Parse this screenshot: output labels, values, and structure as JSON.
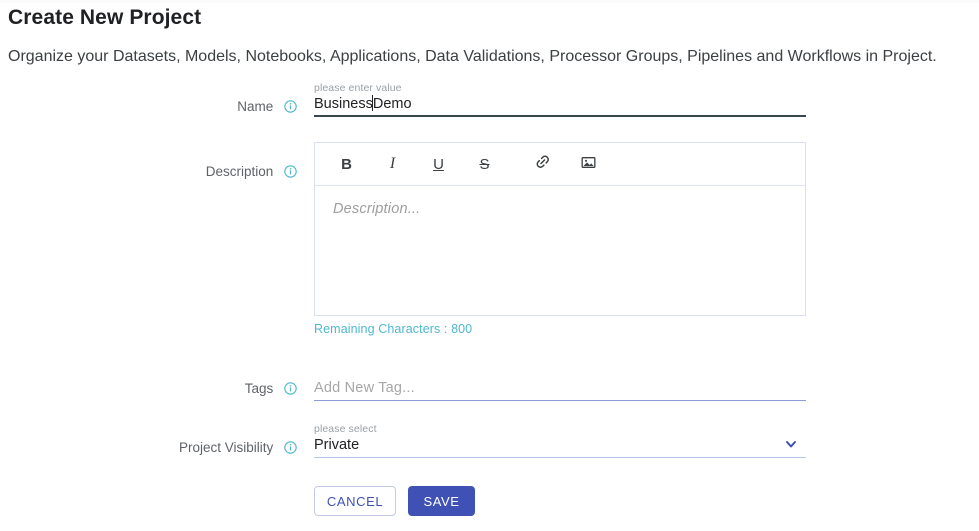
{
  "header": {
    "title": "Create New Project",
    "subtitle": "Organize your Datasets, Models, Notebooks, Applications, Data Validations, Processor Groups, Pipelines and Workflows in Project."
  },
  "colors": {
    "primary": "#3f51b5",
    "info_icon": "#4fb8cf",
    "remaining_text": "#4fb8cf",
    "focused_underline": "#37474f",
    "normal_underline": "#8c9eda",
    "label_text": "#5f6368",
    "placeholder_text": "#a7a7a7"
  },
  "form": {
    "name": {
      "label": "Name",
      "info_icon": "info-circle-icon",
      "placeholder": "please enter value",
      "value_before_caret": "Business",
      "value_after_caret": "Demo",
      "value": "BusinessDemo"
    },
    "description": {
      "label": "Description",
      "info_icon": "info-circle-icon",
      "placeholder": "Description...",
      "value": "",
      "toolbar": [
        {
          "name": "bold-button",
          "label": "B"
        },
        {
          "name": "italic-button",
          "label": "I"
        },
        {
          "name": "underline-button",
          "label": "U"
        },
        {
          "name": "strikethrough-button",
          "label": "S"
        },
        {
          "name": "link-button",
          "label": "link-icon"
        },
        {
          "name": "image-button",
          "label": "image-icon"
        }
      ],
      "remaining_characters": "Remaining Characters : 800"
    },
    "tags": {
      "label": "Tags",
      "info_icon": "info-circle-icon",
      "placeholder": "Add New Tag...",
      "value": ""
    },
    "visibility": {
      "label": "Project Visibility",
      "info_icon": "info-circle-icon",
      "placeholder": "please select",
      "value": "Private",
      "chevron": "chevron-down-icon"
    }
  },
  "actions": {
    "cancel_label": "CANCEL",
    "save_label": "SAVE"
  }
}
